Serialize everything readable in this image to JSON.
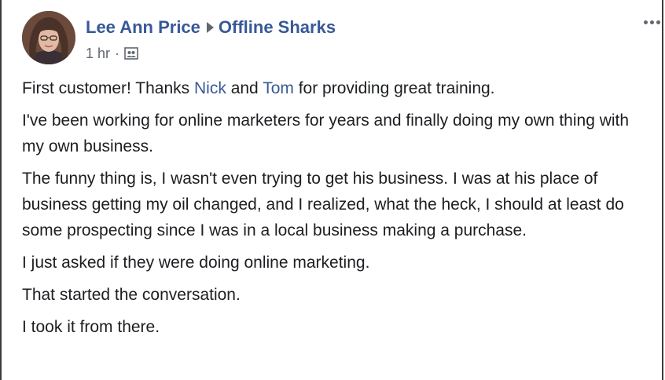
{
  "post": {
    "author": "Lee Ann Price",
    "group": "Offline Sharks",
    "timestamp": "1 hr",
    "meta_separator": "·",
    "audience_icon": "group-audience-icon",
    "more_icon": "more-options-icon",
    "paragraphs": [
      {
        "before": "First customer! Thanks ",
        "mention1": "Nick",
        "middle": " and ",
        "mention2": "Tom",
        "after": " for providing great training."
      },
      {
        "text": "I've been working for online marketers for years and finally doing my own thing with my own business."
      },
      {
        "text": "The funny thing is, I wasn't even trying to get his business. I was at his place of business getting my oil changed, and I realized, what the heck, I should at least do some prospecting since I was in a local business making a purchase."
      },
      {
        "text": "I just asked if they were doing online marketing."
      },
      {
        "text": "That started the conversation."
      },
      {
        "text": "I took it from there."
      }
    ]
  },
  "colors": {
    "link": "#385898",
    "text": "#1c1e21",
    "secondary": "#606770"
  }
}
